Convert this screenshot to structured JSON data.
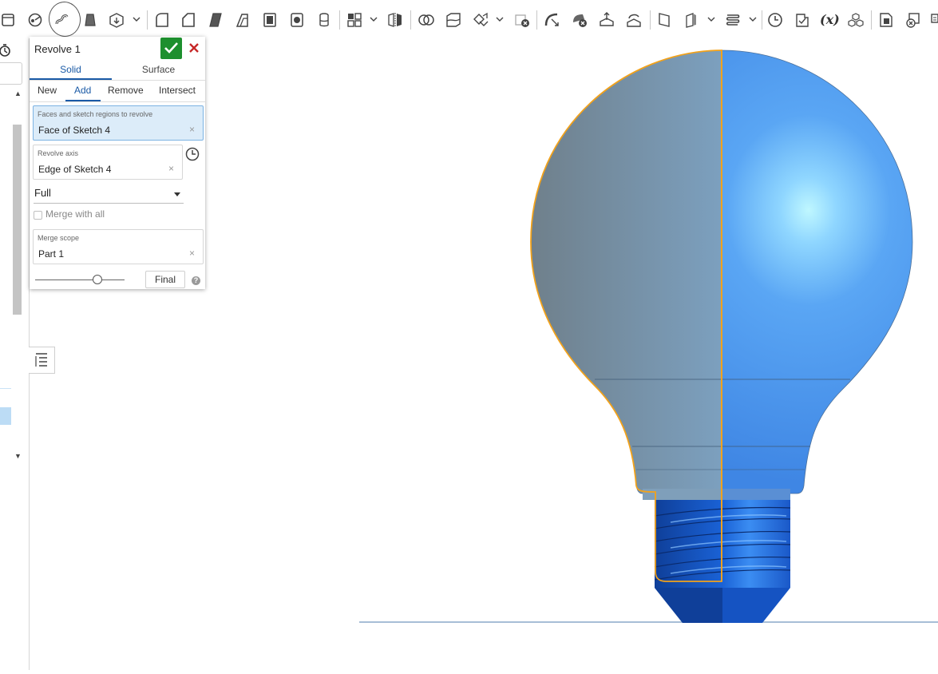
{
  "panel": {
    "title": "Revolve 1",
    "tabs": [
      {
        "label": "Solid",
        "active": true
      },
      {
        "label": "Surface",
        "active": false
      }
    ],
    "operations": [
      {
        "label": "New",
        "active": false
      },
      {
        "label": "Add",
        "active": true
      },
      {
        "label": "Remove",
        "active": false
      },
      {
        "label": "Intersect",
        "active": false
      }
    ],
    "faces_field": {
      "label": "Faces and sketch regions to revolve",
      "value": "Face of Sketch 4",
      "clear": "×"
    },
    "axis_field": {
      "label": "Revolve axis",
      "value": "Edge of Sketch 4",
      "clear": "×"
    },
    "revolve_type": "Full",
    "merge_with_all": {
      "label": "Merge with all",
      "checked": false
    },
    "merge_scope": {
      "label": "Merge scope",
      "value": "Part 1",
      "clear": "×"
    },
    "final_button": "Final",
    "help": "?"
  },
  "toolbar": {
    "variable_label": "(x)",
    "icons": [
      "sketch-icon",
      "extrude-icon",
      "revolve-icon",
      "sweep-icon",
      "loft-icon",
      "thicken-icon",
      "fillet-icon",
      "chamfer-icon",
      "draft-icon",
      "shell-icon",
      "hole-icon",
      "rib-icon",
      "pattern-icon",
      "mirror-icon",
      "boolean-icon",
      "split-icon",
      "transform-icon",
      "delete-part-icon",
      "modify-fillet-icon",
      "delete-face-icon",
      "move-face-icon",
      "replace-face-icon",
      "plane-icon",
      "mate-connector-icon",
      "helix-icon",
      "variable-icon",
      "configurations-icon",
      "import-icon"
    ]
  },
  "colors": {
    "accent": "#1a5aa6",
    "ok_green": "#1d8f2e",
    "cancel_red": "#c62828",
    "selection_orange": "#f2a21b",
    "model_blue": "#4a8fe6",
    "selected_field": "#dcecf9"
  }
}
